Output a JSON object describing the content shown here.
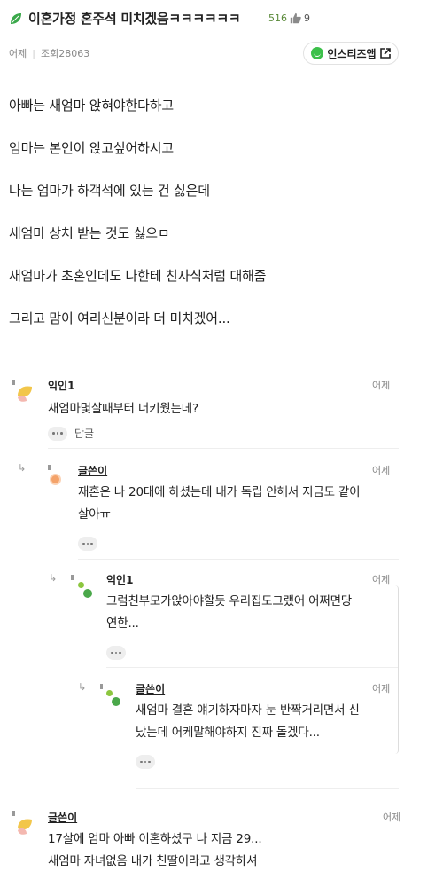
{
  "post": {
    "title": "이혼가정 혼주석 미치겠음ㅋㅋㅋㅋㅋㅋ",
    "views_count": "516",
    "like_count": "9",
    "date": "어제",
    "views_label": "조회28063",
    "app_button": "인스티즈앱",
    "body": [
      "아빠는 새엄마 앉혀야한다하고",
      "엄마는 본인이 앉고싶어하시고",
      "나는 엄마가 하객석에 있는 건 싫은데",
      "새엄마 상처 받는 것도 싫으ㅁ",
      "새엄마가 초혼인데도 나한테 친자식처럼 대해줌",
      "그리고 맘이 여리신분이라 더 미치겠어..."
    ]
  },
  "comments": [
    {
      "name": "익인1",
      "time": "어제",
      "lines": [
        "새엄마몇살때부터 너키웠는데?"
      ],
      "reply_label": "답글"
    },
    {
      "name": "글쓴이",
      "time": "어제",
      "lines": [
        "재혼은 나 20대에 하셨는데 내가 독립 안해서 지금도 같이",
        "살아ㅠ"
      ]
    },
    {
      "name": "익인1",
      "time": "어제",
      "lines": [
        "그럼친부모가앉아야할듯 우리집도그랬어 어쩌면당",
        "연한..."
      ]
    },
    {
      "name": "글쓴이",
      "time": "어제",
      "lines": [
        "새엄마 결혼 얘기하자마자 눈 반짝거리면서 신",
        "났는데 어케말해야하지 진짜 돌겠다..."
      ]
    },
    {
      "name": "글쓴이",
      "time": "어제",
      "lines": [
        "17살에 엄마 아빠 이혼하셨구 나 지금 29...",
        "새엄마 자녀없음 내가 친딸이라고 생각하셔"
      ]
    }
  ],
  "colors": {
    "accent_green": "#3cc04a",
    "text": "#222222",
    "muted": "#888888"
  }
}
